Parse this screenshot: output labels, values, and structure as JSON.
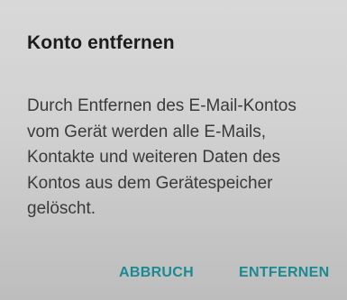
{
  "dialog": {
    "title": "Konto entfernen",
    "message_lines": [
      "Durch Entfernen des E-Mail-Kontos",
      "vom Gerät werden alle E-Mails,",
      "Kontakte und weiteren Daten des",
      "Kontos aus dem Gerätespeicher",
      "gelöscht."
    ],
    "buttons": {
      "cancel_label": "ABBRUCH",
      "remove_label": "ENTFERNEN"
    }
  },
  "colors": {
    "accent": "#1a8a92",
    "title_text": "#1c1c1c",
    "body_text": "#3a3a3a"
  }
}
